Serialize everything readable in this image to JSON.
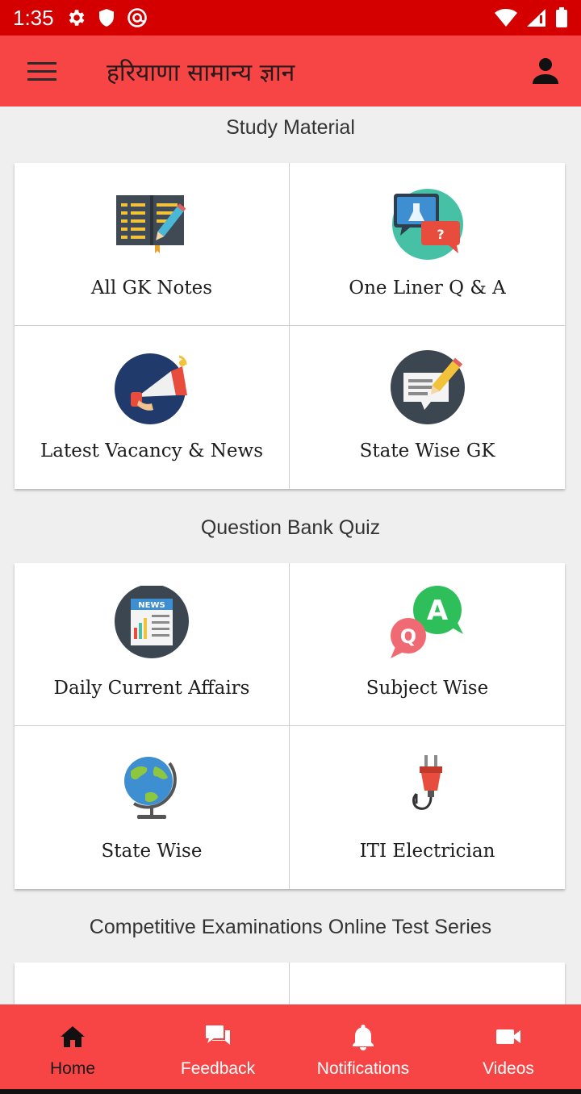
{
  "status_bar": {
    "time": "1:35"
  },
  "app_bar": {
    "title": "हरियाणा सामान्य ज्ञान"
  },
  "sections": [
    {
      "title": "Study Material",
      "tiles": [
        {
          "label": "All GK Notes",
          "icon": "notebook-icon"
        },
        {
          "label": "One Liner Q & A",
          "icon": "chat-bubbles-icon"
        },
        {
          "label": "Latest Vacancy & News",
          "icon": "megaphone-icon"
        },
        {
          "label": "State Wise GK",
          "icon": "message-pencil-icon"
        }
      ]
    },
    {
      "title": "Question Bank Quiz",
      "tiles": [
        {
          "label": "Daily Current Affairs",
          "icon": "newspaper-icon",
          "icon_text": "NEWS"
        },
        {
          "label": "Subject Wise",
          "icon": "qa-bubbles-icon",
          "icon_text_a": "A",
          "icon_text_q": "Q"
        },
        {
          "label": "State Wise",
          "icon": "globe-icon"
        },
        {
          "label": "ITI Electrician",
          "icon": "electric-plug-icon"
        }
      ]
    },
    {
      "title": "Competitive Examinations Online Test Series",
      "tiles": [
        {
          "label": "",
          "icon": "badge-icon"
        },
        {
          "label": "",
          "icon": ""
        }
      ]
    }
  ],
  "bottom_nav": [
    {
      "label": "Home",
      "icon": "home-icon",
      "active": true
    },
    {
      "label": "Feedback",
      "icon": "feedback-icon",
      "active": false
    },
    {
      "label": "Notifications",
      "icon": "bell-icon",
      "active": false
    },
    {
      "label": "Videos",
      "icon": "video-camera-icon",
      "active": false
    }
  ],
  "colors": {
    "status_bar": "#d40000",
    "app_bar": "#f74545",
    "bottom_nav": "#f74545",
    "background": "#efefef"
  }
}
